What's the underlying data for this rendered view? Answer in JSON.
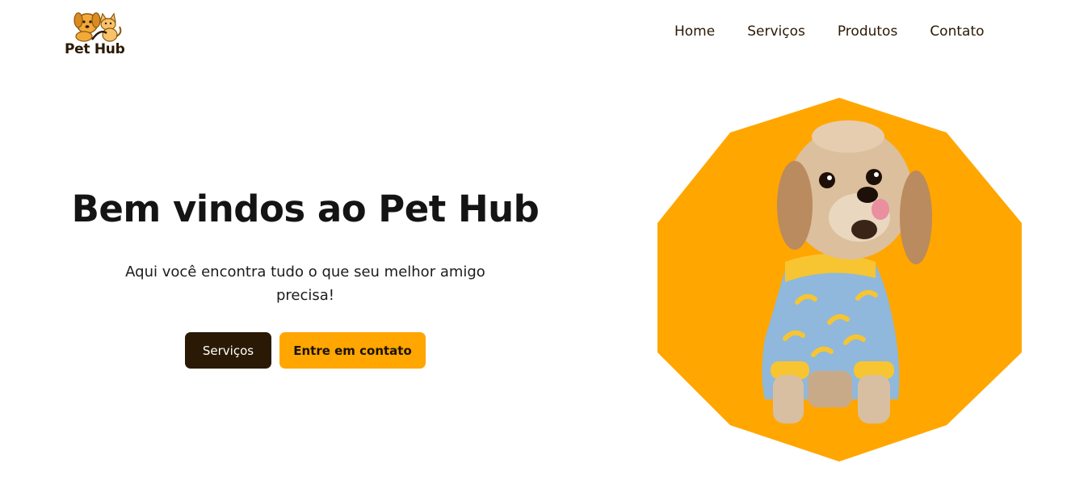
{
  "brand": {
    "name": "Pet Hub",
    "accent_color": "#ffa600",
    "dark_color": "#2a1a05",
    "logo_icon": "dog-and-cat-icon"
  },
  "nav": {
    "items": [
      {
        "label": "Home"
      },
      {
        "label": "Serviços"
      },
      {
        "label": "Produtos"
      },
      {
        "label": "Contato"
      }
    ]
  },
  "hero": {
    "title": "Bem vindos ao Pet Hub",
    "subtitle": "Aqui você encontra tudo o que seu melhor amigo precisa!",
    "primary_button": "Serviços",
    "secondary_button": "Entre em contato",
    "image_icon": "dog-in-banana-pajamas-image",
    "image_background": "#ffa600"
  }
}
